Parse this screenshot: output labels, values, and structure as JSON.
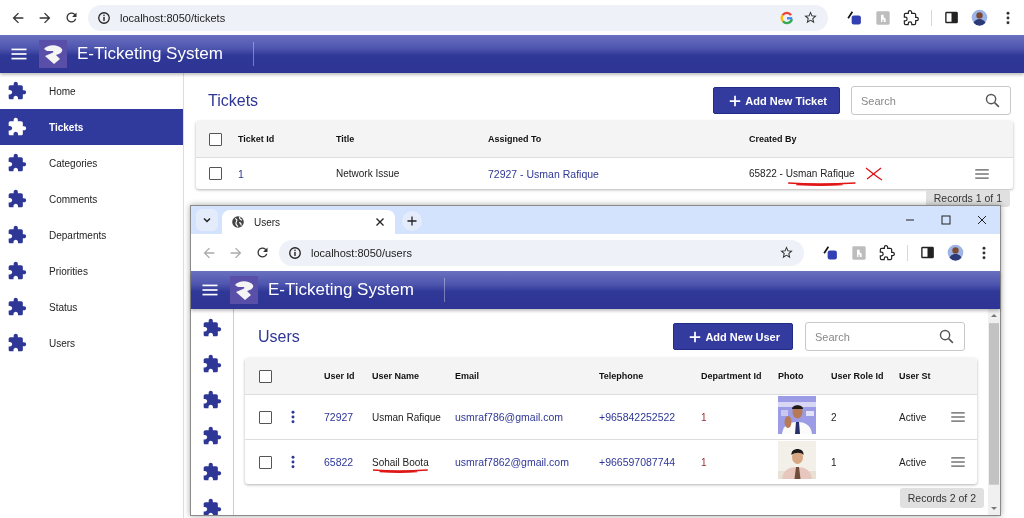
{
  "browser": {
    "url": "localhost:8050/tickets",
    "back_enabled": true,
    "forward_enabled": true
  },
  "app": {
    "title": "E-Ticketing System"
  },
  "sidebar": {
    "items": [
      {
        "label": "Home",
        "selected": false
      },
      {
        "label": "Tickets",
        "selected": true
      },
      {
        "label": "Categories",
        "selected": false
      },
      {
        "label": "Comments",
        "selected": false
      },
      {
        "label": "Departments",
        "selected": false
      },
      {
        "label": "Priorities",
        "selected": false
      },
      {
        "label": "Status",
        "selected": false
      },
      {
        "label": "Users",
        "selected": false
      }
    ]
  },
  "page": {
    "title": "Tickets",
    "add_button": "Add New Ticket",
    "search": {
      "placeholder": "Search"
    }
  },
  "table": {
    "all_checked": false,
    "row_menu": false,
    "columns": [
      {
        "label": "Ticket Id",
        "kind": "link"
      },
      {
        "label": "Title",
        "kind": "text"
      },
      {
        "label": "Assigned To",
        "kind": "link"
      },
      {
        "label": "Created By",
        "kind": "text"
      }
    ],
    "rows": [
      {
        "checked": false,
        "cells": [
          "1",
          "Network Issue",
          "72927 - Usman Rafique",
          {
            "text": "65822 - Usman Rafique",
            "underlined": true,
            "crossed": true
          }
        ]
      }
    ]
  },
  "records": "Records 1 of 1",
  "popup_window": {
    "tab_title": "Users",
    "url": "localhost:8050/users",
    "back_enabled": false,
    "forward_enabled": false,
    "app": {
      "title": "E-Ticketing System"
    },
    "page": {
      "title": "Users",
      "add_button": "Add New User",
      "search": {
        "placeholder": "Search"
      }
    },
    "table": {
      "all_checked": false,
      "row_menu": true,
      "columns": [
        {
          "label": "User Id",
          "kind": "link"
        },
        {
          "label": "User Name",
          "kind": "text"
        },
        {
          "label": "Email",
          "kind": "link"
        },
        {
          "label": "Telephone",
          "kind": "link"
        },
        {
          "label": "Department Id",
          "kind": "accent"
        },
        {
          "label": "Photo"
        },
        {
          "label": "User Role Id",
          "kind": "text"
        },
        {
          "label": "User St",
          "kind": "text"
        }
      ],
      "rows": [
        {
          "checked": false,
          "cells": [
            "72927",
            "Usman Rafique",
            "usmraf786@gmail.com",
            "+965842252522",
            "1",
            {
              "kind": "picture"
            },
            "2",
            "Active"
          ]
        },
        {
          "checked": false,
          "cells": [
            "65822",
            {
              "text": "Sohail Boota",
              "underlined": true,
              "crossed": false
            },
            "usmraf7862@gmail.com",
            "+966597087744",
            "1",
            {
              "kind": "picture"
            },
            "1",
            "Active"
          ]
        }
      ]
    },
    "records": "Records 2 of 2"
  }
}
